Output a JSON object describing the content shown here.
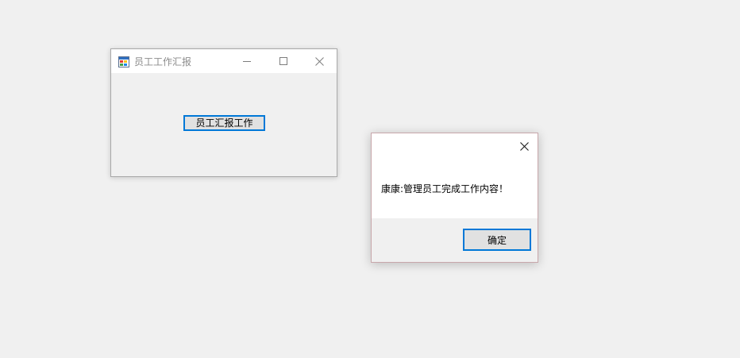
{
  "main_window": {
    "title": "员工工作汇报",
    "app_icon": "winforms-app-icon",
    "controls": {
      "minimize_icon": "minimize-icon",
      "maximize_icon": "maximize-icon",
      "close_icon": "close-icon"
    },
    "report_button_label": "员工汇报工作"
  },
  "message_box": {
    "message": "康康:管理员工完成工作内容！",
    "close_icon": "close-icon",
    "ok_label": "确定"
  },
  "colors": {
    "desktop_bg": "#f0f0f0",
    "titlebar_bg": "#ffffff",
    "focus_border": "#0078d7",
    "button_face": "#e1e1e1",
    "title_text": "#8c8c8c",
    "msgbox_border": "#c8a7ab"
  }
}
